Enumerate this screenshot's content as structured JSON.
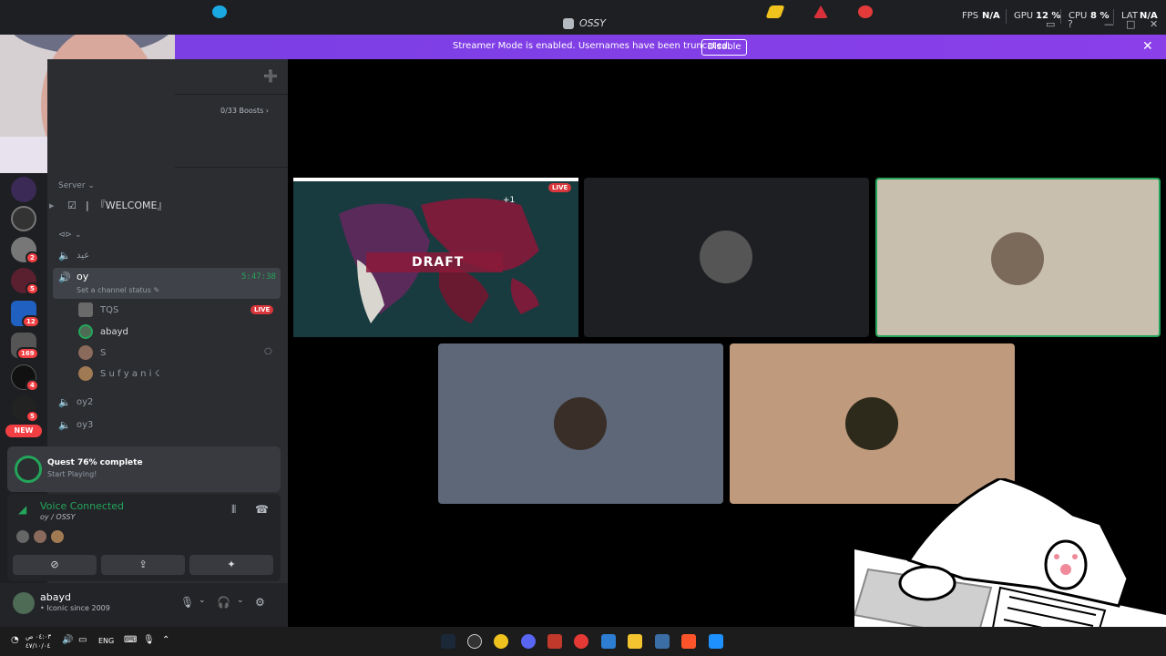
{
  "window": {
    "title": "OSSY"
  },
  "overlay": {
    "fps_label": "FPS",
    "fps_value": "N/A",
    "gpu_label": "GPU",
    "gpu_value": "12 %",
    "cpu_label": "CPU",
    "cpu_value": "8 %",
    "lat_label": "LAT",
    "lat_value": "N/A"
  },
  "banner": {
    "text": "Streamer Mode is enabled. Usernames have been truncated.",
    "button": "Disable"
  },
  "rail": {
    "badges": [
      "2",
      "5",
      "12",
      "169",
      "4",
      "5"
    ],
    "new_label": "NEW"
  },
  "sidebar": {
    "boosts": "0/33 Boosts",
    "category": "Server",
    "welcome": "『WELCOME』",
    "collapsed_label": "⊲⊳",
    "channels": [
      {
        "name": "عيد"
      },
      {
        "name": "oy",
        "time": "5:47:38",
        "status": "Set a channel status"
      },
      {
        "name": "oy2"
      },
      {
        "name": "oy3"
      }
    ],
    "voice_users": [
      {
        "name": "TQS",
        "live": "LIVE"
      },
      {
        "name": "abayd"
      },
      {
        "name": "S"
      },
      {
        "name": "S u f y a n i ☇"
      }
    ]
  },
  "quest": {
    "title": "Quest 76% complete",
    "subtitle": "Start Playing!",
    "progress": 0.76
  },
  "voice": {
    "title": "Voice Connected",
    "location": "oy / OSSY",
    "buttons": [
      "camera-off",
      "share-screen",
      "activities"
    ]
  },
  "user": {
    "name": "abayd",
    "status": "Iconic since 2009"
  },
  "stage": {
    "stream_live": "LIVE",
    "stream_overlay_text": "DRAFT",
    "stream_plus_one": "+1",
    "tile_colors": [
      "#1e1f22",
      "#c8bfae",
      "#5d6777",
      "#bf9a7c"
    ],
    "speaking_border": "#23a55a"
  },
  "taskbar": {
    "time_line1": "٠٤:٠٣ ص",
    "time_line2": "٤٧/١٠/٠٤",
    "lang": "ENG"
  },
  "colors": {
    "accent": "#5865f2",
    "banner": "#7b3fe4",
    "online": "#23a55a",
    "danger": "#f23f43"
  }
}
